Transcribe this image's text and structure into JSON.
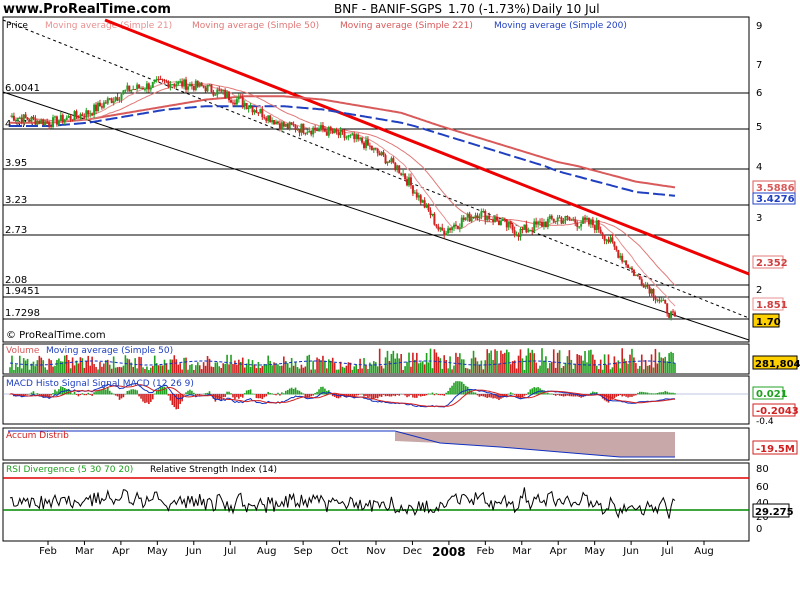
{
  "header": {
    "site": "www.ProRealTime.com",
    "instrument": "BNF - BANIF-SGPS",
    "price_change": "1.70 (-1.73%)",
    "period": "Daily",
    "date": "10 Jul"
  },
  "legend": {
    "price": "Price",
    "ma21": "Moving average (Simple 21)",
    "ma50": "Moving average (Simple 50)",
    "ma221": "Moving average (Simple 221)",
    "ma200": "Moving average (Simple 200)"
  },
  "copyright": "© ProRealTime.com",
  "colors": {
    "ma21": "#e89090",
    "ma50": "#e07878",
    "ma221": "#d85a5a",
    "ma200": "#2040c0",
    "resistance": "#ee0000",
    "candle_up": "#20a020",
    "candle_down": "#d02020",
    "volume_ma": "#1030c0",
    "rsi_upper": "#e00000",
    "rsi_lower": "#008800",
    "accum_fill": "#c8a8a8",
    "price_label_bg": "#ffd000"
  },
  "price_panel": {
    "right_axis_ticks": [
      "9",
      "7",
      "6",
      "5",
      "4",
      "3",
      "2"
    ],
    "horizontal_levels": [
      "6.0041",
      "4.975",
      "3.95",
      "3.23",
      "2.73",
      "2.08",
      "1.9451",
      "1.7298"
    ],
    "value_labels": {
      "ma221": "3.5886",
      "ma200": "3.4276",
      "ma50": "2.352",
      "ma21": "1.851",
      "last": "1.70"
    }
  },
  "volume_panel": {
    "title": "Volume",
    "ma": "Moving average (Simple 50)",
    "value": "281,804"
  },
  "macd_panel": {
    "title": "MACD Histo Signal Signal MACD (12 26 9)",
    "signal_value": "0.021",
    "macd_value": "-0.2043",
    "tick": "-0.4"
  },
  "accum_panel": {
    "title": "Accum Distrib",
    "value": "-19.5M"
  },
  "rsi_panel": {
    "title1": "RSI Divergence (5 30 70 20)",
    "title2": "Relative Strength Index (14)",
    "ticks": [
      "80",
      "60",
      "40",
      "20",
      "0"
    ],
    "value": "29.275"
  },
  "x_axis": {
    "labels": [
      "Feb",
      "Mar",
      "Apr",
      "May",
      "Jun",
      "Jul",
      "Aug",
      "Sep",
      "Oct",
      "Nov",
      "Dec",
      "2008",
      "Feb",
      "Mar",
      "Apr",
      "May",
      "Jun",
      "Jul",
      "Aug"
    ]
  },
  "chart_data": {
    "type": "line",
    "title": "BNF - BANIF-SGPS",
    "xlabel": "",
    "ylabel": "Price",
    "x": [
      "2007-02",
      "2007-03",
      "2007-04",
      "2007-05",
      "2007-06",
      "2007-07",
      "2007-08",
      "2007-09",
      "2007-10",
      "2007-11",
      "2007-12",
      "2008-01",
      "2008-02",
      "2008-03",
      "2008-04",
      "2008-05",
      "2008-06",
      "2008-07"
    ],
    "series": [
      {
        "name": "Price",
        "values": [
          5.3,
          5.1,
          5.4,
          6.1,
          6.4,
          6.2,
          5.7,
          5.0,
          4.9,
          4.6,
          3.9,
          2.8,
          3.1,
          2.8,
          3.0,
          2.9,
          2.2,
          1.7
        ]
      },
      {
        "name": "Moving average (Simple 221)",
        "values": [
          5.1,
          5.1,
          5.2,
          5.4,
          5.6,
          5.8,
          5.9,
          5.9,
          5.8,
          5.6,
          5.4,
          5.0,
          4.7,
          4.4,
          4.1,
          3.9,
          3.7,
          3.5886
        ]
      },
      {
        "name": "Moving average (Simple 200)",
        "values": [
          5.0,
          5.0,
          5.1,
          5.3,
          5.5,
          5.6,
          5.6,
          5.6,
          5.5,
          5.3,
          5.1,
          4.8,
          4.5,
          4.2,
          3.9,
          3.7,
          3.5,
          3.4276
        ]
      }
    ],
    "ylim": [
      1.5,
      9
    ],
    "annotations": [
      "6.0041",
      "4.975",
      "3.95",
      "3.23",
      "2.73",
      "2.08",
      "1.9451",
      "1.7298"
    ],
    "last_value": 1.7,
    "change_pct": -1.73
  }
}
